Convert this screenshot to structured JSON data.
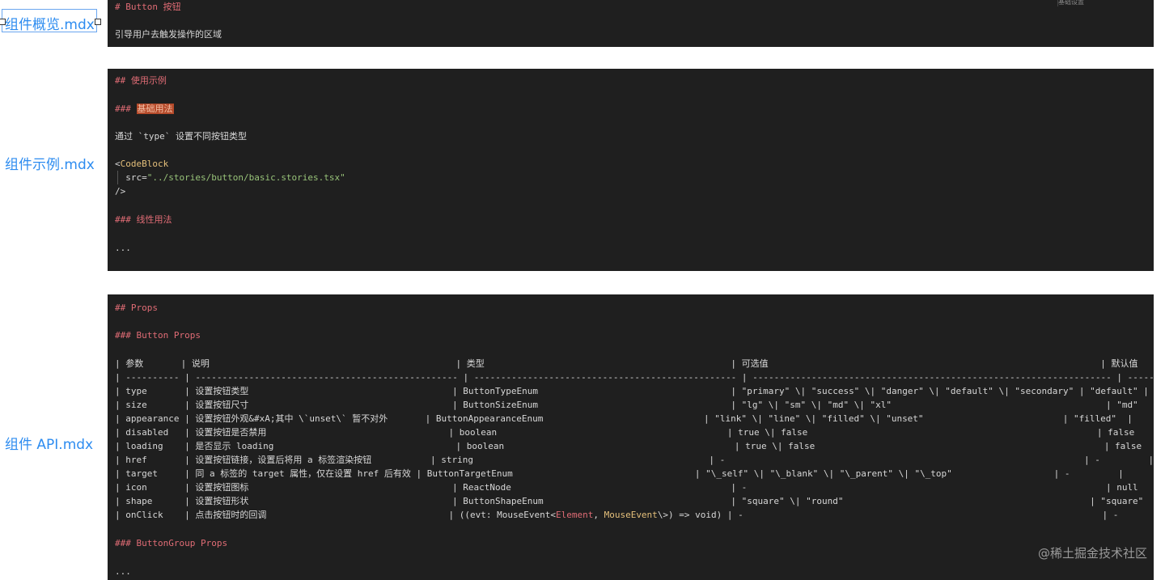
{
  "labels": {
    "overview": "组件概览.mdx",
    "example": "组件示例.mdx",
    "api": "组件 API.mdx"
  },
  "panel1": {
    "line1": "# Button 按钮",
    "line2": "引导用户去触发操作的区域",
    "toolbar_stub": "基础设置"
  },
  "panel2": {
    "h2": "## 使用示例",
    "h3_prefix": "### ",
    "h3_text": "基础用法",
    "desc": "通过 `type` 设置不同按钮类型",
    "tag_open": "<",
    "tag_name": "CodeBlock",
    "src_attr": "  src=",
    "src_val": "\"../stories/button/basic.stories.tsx\"",
    "tag_close": "/>",
    "h3b": "### 线性用法",
    "ellipsis": "..."
  },
  "panel3": {
    "h2": "## Props",
    "h3": "### Button Props",
    "rows": [
      "| 参数       | 说明                                              | 类型                                              | 可选值                                                              | 默认值    |",
      "| ---------- | ------------------------------------------------- | ------------------------------------------------- | ------------------------------------------------------------------- | --------- |",
      "| type       | 设置按钮类型                                      | ButtonTypeEnum                                    | \"primary\" \\| \"success\" \\| \"danger\" \\| \"default\" \\| \"secondary\" | \"default\" |",
      "| size       | 设置按钮尺寸                                      | ButtonSizeEnum                                    | \"lg\" \\| \"sm\" \\| \"md\" \\| \"xl\"                                        | \"md\"      |",
      "| appearance | 设置按钮外观&#xA;其中 \\`unset\\` 暂不对外       | ButtonAppearanceEnum                              | \"link\" \\| \"line\" \\| \"filled\" \\| \"unset\"                          | \"filled\"  |",
      "| disabled   | 设置按钮是否禁用                                  | boolean                                           | true \\| false                                                      | false     |",
      "| loading    | 是否显示 loading                                  | boolean                                           | true \\| false                                                      | false     |",
      "| href       | 设置按钮链接，设置后将用 a 标签渲染按钮           | string                                            | -                                                                   | -         |",
      "| target     | 同 a 标签的 target 属性，仅在设置 href 后有效 | ButtonTargetEnum                                  | \"\\_self\" \\| \"\\_blank\" \\| \"\\_parent\" \\| \"\\_top\"                   | -         |",
      "| icon       | 设置按钮图标                                      | ReactNode                                         | -                                                                   | null      |",
      "| shape      | 设置按钮形状                                      | ButtonShapeEnum                                   | \"square\" \\| \"round\"                                              | \"square\"  |"
    ],
    "onclick_prefix": "| onClick    | 点击按钮时的回调                                  | ((evt: MouseEvent<",
    "onclick_el": "Element",
    "onclick_mid": ", ",
    "onclick_me": "MouseEvent",
    "onclick_suffix": "\\>) => void) | -                                                                   | -         |",
    "h3b": "### ButtonGroup Props",
    "ellipsis": "..."
  },
  "watermark": "@稀土掘金技术社区"
}
